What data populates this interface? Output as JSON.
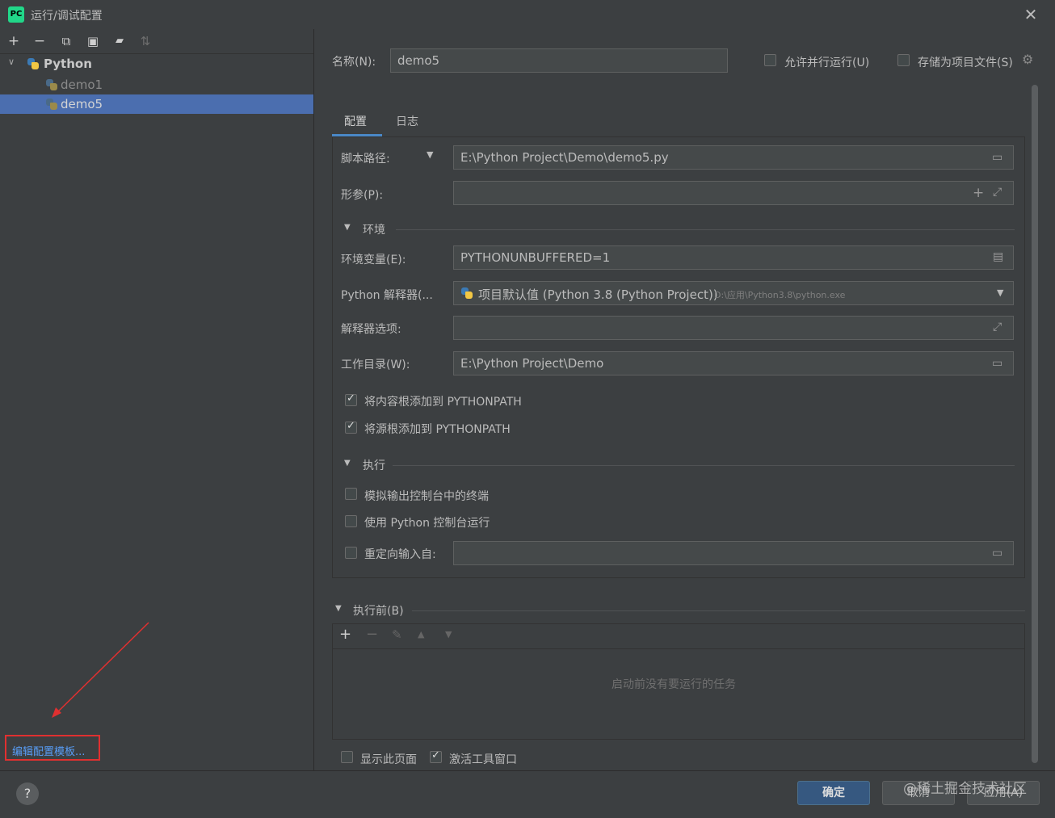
{
  "window": {
    "title": "运行/调试配置",
    "logo_text": "PC"
  },
  "toolbar": {
    "add": "+",
    "remove": "−",
    "copy": "⧉",
    "save": "▣",
    "folder": "▰",
    "sort": "⇅"
  },
  "tree": {
    "group_label": "Python",
    "items": [
      {
        "label": "demo1"
      },
      {
        "label": "demo5"
      }
    ]
  },
  "edit_templates_link": "编辑配置模板...",
  "help_label": "?",
  "name_field": {
    "label": "名称(N):",
    "value": "demo5"
  },
  "allow_parallel": {
    "label": "允许并行运行(U)",
    "checked": false
  },
  "store_as_project_file": {
    "label": "存储为项目文件(S)",
    "checked": false
  },
  "tabs": [
    {
      "label": "配置",
      "active": true
    },
    {
      "label": "日志",
      "active": false
    }
  ],
  "config": {
    "script_path": {
      "label": "脚本路径:",
      "value": "E:\\Python Project\\Demo\\demo5.py"
    },
    "parameters": {
      "label": "形参(P):",
      "value": ""
    },
    "env_section": "环境",
    "env_vars": {
      "label": "环境变量(E):",
      "value": "PYTHONUNBUFFERED=1"
    },
    "interpreter": {
      "label": "Python 解释器(...",
      "value": "项目默认值 (Python 3.8 (Python Project))",
      "path": "D:\\应用\\Python3.8\\python.exe"
    },
    "interpreter_options": {
      "label": "解释器选项:",
      "value": ""
    },
    "working_dir": {
      "label": "工作目录(W):",
      "value": "E:\\Python Project\\Demo"
    },
    "add_content_roots": {
      "label": "将内容根添加到 PYTHONPATH",
      "checked": true
    },
    "add_source_roots": {
      "label": "将源根添加到 PYTHONPATH",
      "checked": true
    },
    "exec_section": "执行",
    "emulate_terminal": {
      "label": "模拟输出控制台中的终端",
      "checked": false
    },
    "python_console": {
      "label": "使用 Python 控制台运行",
      "checked": false
    },
    "redirect_input": {
      "label": "重定向输入自:",
      "checked": false,
      "value": ""
    }
  },
  "before_launch": {
    "label": "执行前(B)",
    "empty_text": "启动前没有要运行的任务"
  },
  "show_page": {
    "label": "显示此页面",
    "checked": false
  },
  "activate_tool_window": {
    "label": "激活工具窗口",
    "checked": true
  },
  "buttons": {
    "ok": "确定",
    "cancel": "取消",
    "apply": "应用(A)"
  },
  "watermark": "@稀土掘金技术社区",
  "colors": {
    "selection": "#4b6eaf",
    "link": "#589df6",
    "highlight_box": "#e03030",
    "primary_button": "#365880"
  }
}
